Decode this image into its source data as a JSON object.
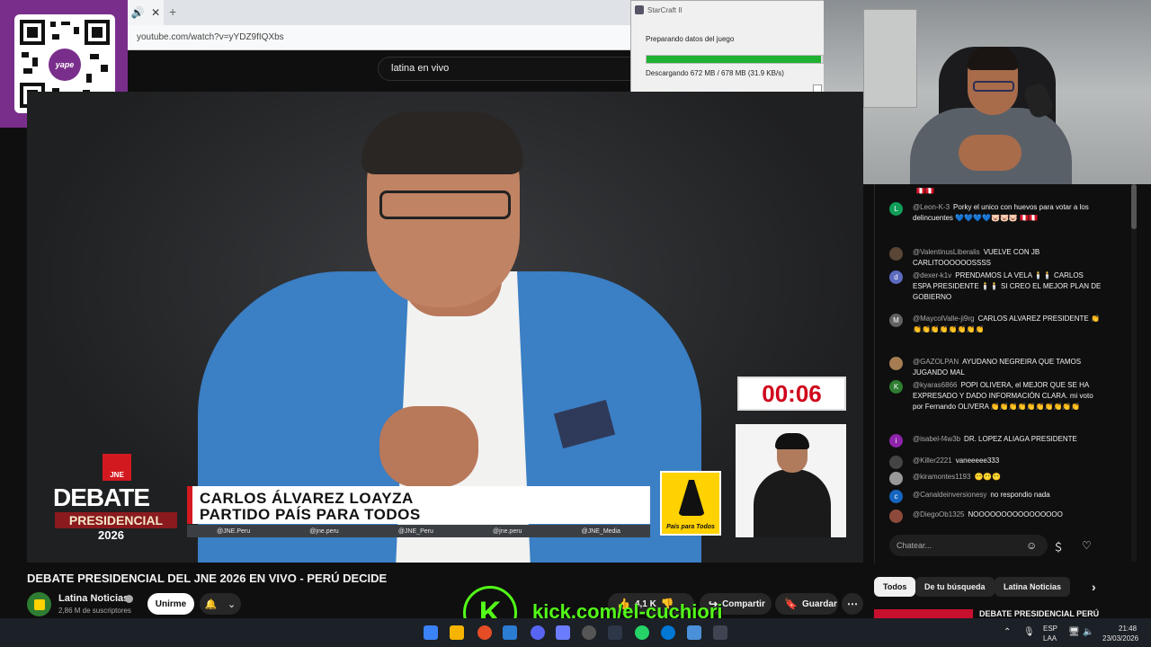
{
  "browser": {
    "url": "youtube.com/watch?v=yYDZ9fIQXbs"
  },
  "youtube": {
    "search_value": "latina en vivo"
  },
  "qr": {
    "brand": "yape"
  },
  "starcraft_window": {
    "title": "StarCraft II",
    "status": "Preparando datos del juego",
    "progress": 0.991,
    "download_text": "Descargando 672 MB / 678 MB  (31.9 KB/s)"
  },
  "video": {
    "timer": "00:06",
    "brand_badge": "JNE",
    "debate_word": "DEBATE",
    "presidential_word": "PRESIDENCIAL",
    "year": "2026",
    "name_line1": "CARLOS ÁLVAREZ LOAYZA",
    "name_line2": "PARTIDO PAÍS PARA TODOS",
    "social": [
      "@JNE.Peru",
      "@jne.peru",
      "@JNE_Peru",
      "@jne.peru",
      "@JNE_Media"
    ],
    "party_label": "País para Todos"
  },
  "video_info": {
    "title": "DEBATE PRESIDENCIAL DEL JNE 2026 EN VIVO - PERÚ DECIDE",
    "channel": "Latina Noticias",
    "subscribers": "2,86 M de suscriptores",
    "join_label": "Unirme",
    "likes": "4,1 K",
    "share_label": "Compartir",
    "save_label": "Guardar"
  },
  "kick": {
    "letter": "K",
    "url": "kick.com/el-cuchiori"
  },
  "chat": {
    "messages": [
      {
        "user": "",
        "text": "🇵🇪🇵🇪",
        "avatar_color": "#7a2e8c",
        "initial": ""
      },
      {
        "user": "@Leon-K-3",
        "text": "Porky el unico con huevos para votar a los delincuentes 💙💙💙💙🐷🐷🐷 🇵🇪🇵🇪",
        "avatar_color": "#0f9d58",
        "initial": "L"
      },
      {
        "user": "@ValentinusLiberalis",
        "text": "VUELVE CON JB CARLITOOOOOOSSSS",
        "avatar_color": "#5b4636",
        "initial": ""
      },
      {
        "user": "@dexer-k1v",
        "text": "PRENDAMOS LA VELA 🕯️🕯️ CARLOS ESPA PRESIDENTE 🕯️🕯️ SI CREO EL MEJOR PLAN DE GOBIERNO",
        "avatar_color": "#5c6bc0",
        "initial": "d"
      },
      {
        "user": "@MaycolValle-ji9rg",
        "text": "CARLOS ALVAREZ PRESIDENTE 👏👏👏👏👏👏👏👏👏",
        "avatar_color": "#616161",
        "initial": "M"
      },
      {
        "user": "@GAZOLPAN",
        "text": "AYUDANO NEGREIRA QUE TAMOS JUGANDO MAL",
        "avatar_color": "#a67c52",
        "initial": ""
      },
      {
        "user": "@kyaras6866",
        "text": "POPI OLIVERA, el MEJOR QUE SE HA EXPRESADO Y DADO INFORMACIÓN CLARA. mi voto por Fernando OLIVERA 👏👏👏👏👏👏👏👏👏👏",
        "avatar_color": "#2e7d32",
        "initial": "K"
      },
      {
        "user": "@isabel-f4w3b",
        "text": "DR. LOPEZ ALIAGA PRESIDENTE",
        "avatar_color": "#8e24aa",
        "initial": "i"
      },
      {
        "user": "@Killer2221",
        "text": "vaneeeee333",
        "avatar_color": "#444",
        "initial": ""
      },
      {
        "user": "@kiramontes1193",
        "text": "😶😶😶",
        "avatar_color": "#999",
        "initial": ""
      },
      {
        "user": "@Canaldeinversionesy",
        "text": "no respondio nada",
        "avatar_color": "#1565c0",
        "initial": "c"
      },
      {
        "user": "@DiegoOb1325",
        "text": "NOOOOOOOOOOOOOOOO",
        "avatar_color": "#8d4a3a",
        "initial": ""
      }
    ],
    "input_placeholder": "Chatear..."
  },
  "related": {
    "chips": [
      "Todos",
      "De tu búsqueda",
      "Latina Noticias"
    ],
    "first_title": "DEBATE PRESIDENCIAL PERÚ"
  },
  "taskbar": {
    "lang_top": "ESP",
    "lang_bottom": "LAA",
    "time": "21:48",
    "date": "23/03/2026"
  }
}
